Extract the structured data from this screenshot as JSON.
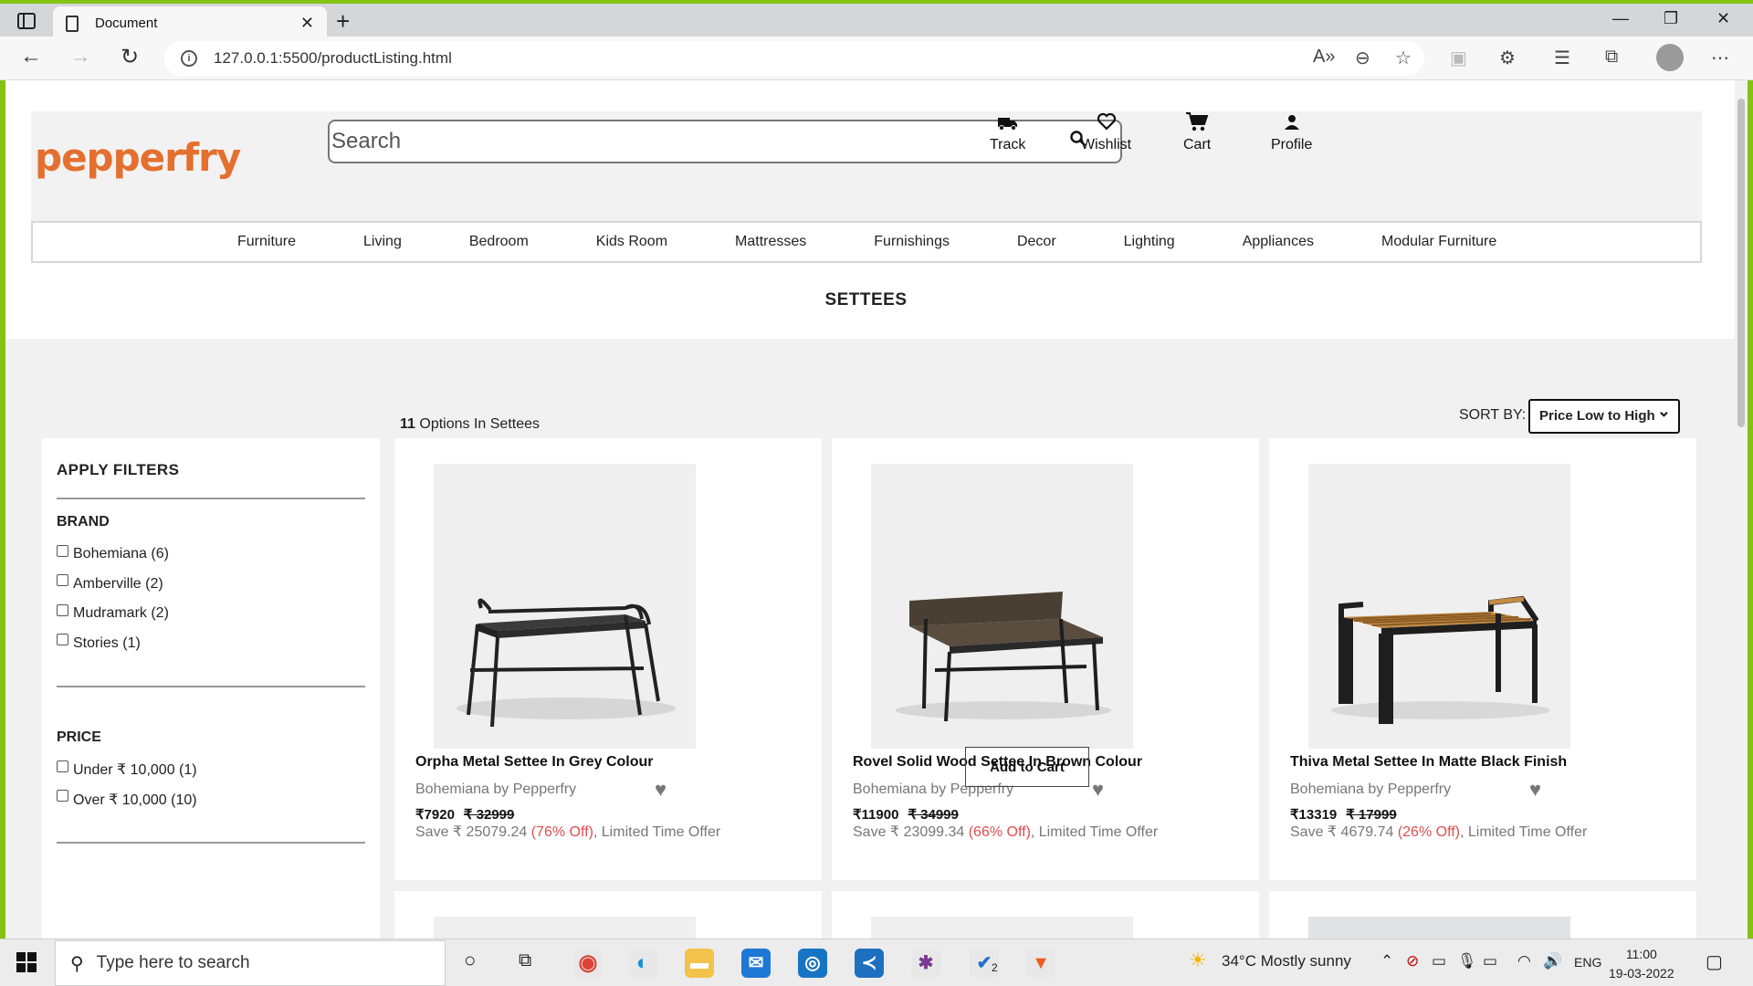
{
  "browser": {
    "tab_title": "Document",
    "url": "127.0.0.1:5500/productListing.html"
  },
  "header": {
    "logo": "pepperfry",
    "search_placeholder": "Search",
    "icons": [
      {
        "name": "track",
        "label": "Track",
        "glyph": "🚚"
      },
      {
        "name": "wishlist",
        "label": "Wishlist",
        "glyph": "♡"
      },
      {
        "name": "cart",
        "label": "Cart",
        "glyph": "🛒"
      },
      {
        "name": "profile",
        "label": "Profile",
        "glyph": "👤"
      }
    ]
  },
  "menu": [
    "Furniture",
    "Living",
    "Bedroom",
    "Kids Room",
    "Mattresses",
    "Furnishings",
    "Decor",
    "Lighting",
    "Appliances",
    "Modular Furniture"
  ],
  "page_heading": "SETTEES",
  "results": {
    "count": "11",
    "label": " Options In Settees"
  },
  "sort": {
    "label": "SORT BY:",
    "selected": "Price Low to High"
  },
  "filters": {
    "title": "APPLY FILTERS",
    "sections": [
      {
        "title": "BRAND",
        "items": [
          "Bohemiana (6)",
          "Amberville (2)",
          "Mudramark (2)",
          "Stories (1)"
        ]
      },
      {
        "title": "PRICE",
        "items": [
          "Under ₹ 10,000 (1)",
          "Over ₹ 10,000 (10)"
        ]
      }
    ]
  },
  "products": [
    {
      "name": "Orpha Metal Settee In Grey Colour",
      "brand": "Bohemiana by Pepperfry",
      "price": "₹7920",
      "mrp": "₹ 32999",
      "save": "Save ₹ 25079.24 ",
      "off": "(76% Off)",
      "offer": ", Limited Time Offer"
    },
    {
      "name": "Rovel Solid Wood Settee In Brown Colour",
      "brand": "Bohemiana by Pepperfry",
      "price": "₹11900",
      "mrp": "₹ 34999",
      "save": "Save ₹ 23099.34 ",
      "off": "(66% Off)",
      "offer": ", Limited Time Offer",
      "add_to_cart": "Add to Cart"
    },
    {
      "name": "Thiva Metal Settee In Matte Black Finish",
      "brand": "Bohemiana by Pepperfry",
      "price": "₹13319",
      "mrp": "₹ 17999",
      "save": "Save ₹ 4679.74 ",
      "off": "(26% Off)",
      "offer": ", Limited Time Offer"
    }
  ],
  "taskbar": {
    "search_placeholder": "Type here to search",
    "weather": "34°C  Mostly sunny",
    "lang": "ENG",
    "time": "11:00",
    "date": "19-03-2022",
    "badge": "2"
  },
  "colors": {
    "accent": "#82c314",
    "logo": "#e56f2e",
    "discount": "#e34c4c"
  }
}
